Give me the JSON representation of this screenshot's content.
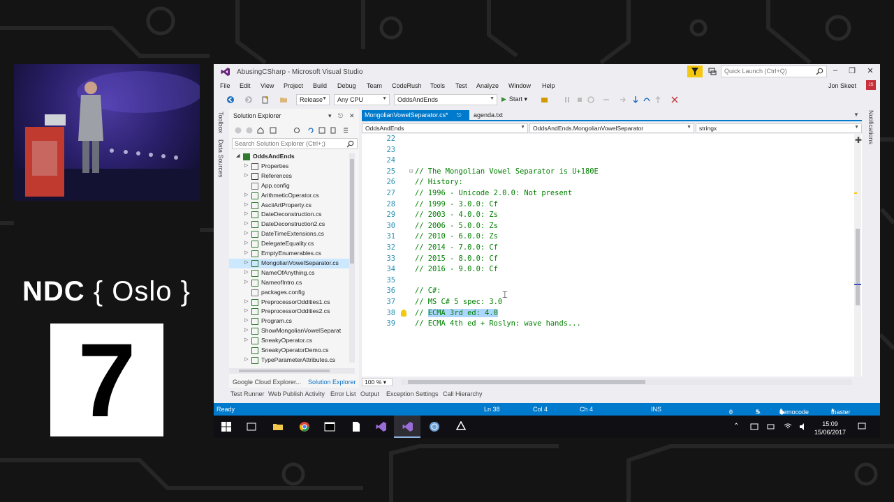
{
  "conference": {
    "brand": "NDC",
    "brace_open": "{",
    "city": "Oslo",
    "brace_close": "}",
    "room_number": "7"
  },
  "window": {
    "title": "AbusingCSharp - Microsoft Visual Studio",
    "quick_launch_placeholder": "Quick Launch (Ctrl+Q)",
    "user_name": "Jon Skeet",
    "user_initials": "JS"
  },
  "menu": [
    "File",
    "Edit",
    "View",
    "Project",
    "Build",
    "Debug",
    "Team",
    "CodeRush",
    "Tools",
    "Test",
    "Analyze",
    "Window",
    "Help"
  ],
  "toolbar": {
    "configuration": "Release",
    "platform": "Any CPU",
    "startup_project": "OddsAndEnds",
    "start_label": "Start"
  },
  "side_tabs": {
    "toolbox": "Toolbox",
    "data_sources": "Data Sources",
    "notifications": "Notifications"
  },
  "solution_explorer": {
    "title": "Solution Explorer",
    "search_placeholder": "Search Solution Explorer (Ctrl+;)",
    "project": "OddsAndEnds",
    "items": [
      {
        "label": "Properties",
        "kind": "folder",
        "expander": true
      },
      {
        "label": "References",
        "kind": "references",
        "expander": true
      },
      {
        "label": "App.config",
        "kind": "config",
        "expander": false
      },
      {
        "label": "ArithmeticOperator.cs",
        "kind": "cs",
        "expander": true
      },
      {
        "label": "AsciiArtProperty.cs",
        "kind": "cs",
        "expander": true
      },
      {
        "label": "DateDeconstruction.cs",
        "kind": "cs",
        "expander": true
      },
      {
        "label": "DateDeconstruction2.cs",
        "kind": "cs",
        "expander": true
      },
      {
        "label": "DateTimeExtensions.cs",
        "kind": "cs",
        "expander": true
      },
      {
        "label": "DelegateEquality.cs",
        "kind": "cs",
        "expander": true
      },
      {
        "label": "EmptyEnumerables.cs",
        "kind": "cs",
        "expander": true
      },
      {
        "label": "MongolianVowelSeparator.cs",
        "kind": "cs",
        "expander": true,
        "selected": true
      },
      {
        "label": "NameOfAnything.cs",
        "kind": "cs",
        "expander": true
      },
      {
        "label": "NameofIntro.cs",
        "kind": "cs",
        "expander": true
      },
      {
        "label": "packages.config",
        "kind": "config",
        "expander": false
      },
      {
        "label": "PreprocessorOddities1.cs",
        "kind": "cs",
        "expander": true
      },
      {
        "label": "PreprocessorOddities2.cs",
        "kind": "cs",
        "expander": true
      },
      {
        "label": "Program.cs",
        "kind": "cs",
        "expander": true
      },
      {
        "label": "ShowMongolianVowelSeparat",
        "kind": "cs",
        "expander": true
      },
      {
        "label": "SneakyOperator.cs",
        "kind": "cs",
        "expander": true
      },
      {
        "label": "SneakyOperatorDemo.cs",
        "kind": "cs",
        "expander": false
      },
      {
        "label": "TypeParameterAttributes.cs",
        "kind": "cs",
        "expander": true
      }
    ],
    "bottom_tabs": [
      "Google Cloud Explorer...",
      "Solution Explorer"
    ]
  },
  "editor": {
    "tabs": [
      {
        "label": "MongolianVowelSeparator.cs*",
        "active": true
      },
      {
        "label": "agenda.txt",
        "active": false
      }
    ],
    "nav_project": "OddsAndEnds",
    "nav_type": "OddsAndEnds.MongolianVowelSeparator",
    "nav_member": "stringx",
    "zoom": "100 %",
    "lines": [
      {
        "n": "22",
        "text": ""
      },
      {
        "n": "23",
        "text": ""
      },
      {
        "n": "24",
        "text": ""
      },
      {
        "n": "25",
        "text": "// The Mongolian Vowel Separator is U+180E"
      },
      {
        "n": "26",
        "text": "// History:"
      },
      {
        "n": "27",
        "text": "// 1996 - Unicode 2.0.0: Not present"
      },
      {
        "n": "28",
        "text": "// 1999 - 3.0.0: Cf"
      },
      {
        "n": "29",
        "text": "// 2003 - 4.0.0: Zs"
      },
      {
        "n": "30",
        "text": "// 2006 - 5.0.0: Zs"
      },
      {
        "n": "31",
        "text": "// 2010 - 6.0.0: Zs"
      },
      {
        "n": "32",
        "text": "// 2014 - 7.0.0: Cf"
      },
      {
        "n": "33",
        "text": "// 2015 - 8.0.0: Cf"
      },
      {
        "n": "34",
        "text": "// 2016 - 9.0.0: Cf"
      },
      {
        "n": "35",
        "text": ""
      },
      {
        "n": "36",
        "text": "// C#:"
      },
      {
        "n": "37",
        "text": "// MS C# 5 spec: 3.0"
      },
      {
        "n": "38",
        "prefix": "// ",
        "selected": "ECMA 3rd ed: 4.0"
      },
      {
        "n": "39",
        "text": "// ECMA 4th ed + Roslyn: wave hands..."
      }
    ]
  },
  "tool_tabs": [
    "Test Runner",
    "Web Publish Activity",
    "Error List",
    "Output",
    "Exception Settings",
    "Call Hierarchy"
  ],
  "status": {
    "state": "Ready",
    "line": "Ln 38",
    "col": "Col 4",
    "ch": "Ch 4",
    "mode": "INS",
    "up_count": "0",
    "pencil_count": "5",
    "repo": "democode",
    "branch": "master"
  },
  "taskbar": {
    "time": "15:09",
    "date": "15/06/2017"
  },
  "colors": {
    "accent": "#007acc",
    "comment": "#008000",
    "line_number": "#2b91af",
    "selection": "#add6ff"
  }
}
